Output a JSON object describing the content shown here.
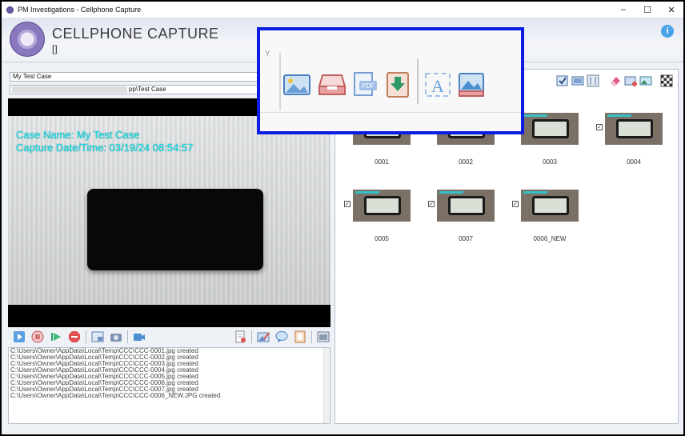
{
  "window": {
    "title": "PM Investigations - Cellphone Capture",
    "minimize_icon": "–",
    "maximize_icon": "☐",
    "close_icon": "✕"
  },
  "header": {
    "app_title": "CELLPHONE CAPTURE",
    "subtitle": "[]",
    "help_icon": "i"
  },
  "case": {
    "name_value": "My Test Case",
    "path_value": "pp\\Test Case"
  },
  "video": {
    "overlay_line1": "Case Name: My Test Case",
    "overlay_line2": "Capture Date/Time: 03/19/24 08:54:57"
  },
  "log": {
    "lines": [
      "C:\\Users\\Owner\\AppData\\Local\\Temp\\CCC\\CCC-0001.jpg created",
      "C:\\Users\\Owner\\AppData\\Local\\Temp\\CCC\\CCC-0002.jpg created",
      "C:\\Users\\Owner\\AppData\\Local\\Temp\\CCC\\CCC-0003.jpg created",
      "C:\\Users\\Owner\\AppData\\Local\\Temp\\CCC\\CCC-0004.jpg created",
      "C:\\Users\\Owner\\AppData\\Local\\Temp\\CCC\\CCC-0005.jpg created",
      "C:\\Users\\Owner\\AppData\\Local\\Temp\\CCC\\CCC-0006.jpg created",
      "C:\\Users\\Owner\\AppData\\Local\\Temp\\CCC\\CCC-0007.jpg created",
      "C:\\Users\\Owner\\AppData\\Local\\Temp\\CCC\\CCC-0006_NEW.JPG created"
    ]
  },
  "thumbnails": [
    {
      "label": "0001",
      "checked": false
    },
    {
      "label": "0002",
      "checked": false
    },
    {
      "label": "0003",
      "checked": false
    },
    {
      "label": "0004",
      "checked": true
    },
    {
      "label": "0005",
      "checked": true
    },
    {
      "label": "0007",
      "checked": true
    },
    {
      "label": "0006_NEW",
      "checked": true
    }
  ],
  "zoom_callout": {
    "partial_text": "Y"
  },
  "colors": {
    "accent_blue": "#0a1de0",
    "overlay_cyan": "#18e0e8",
    "logo_purple": "#6b5aa3"
  }
}
